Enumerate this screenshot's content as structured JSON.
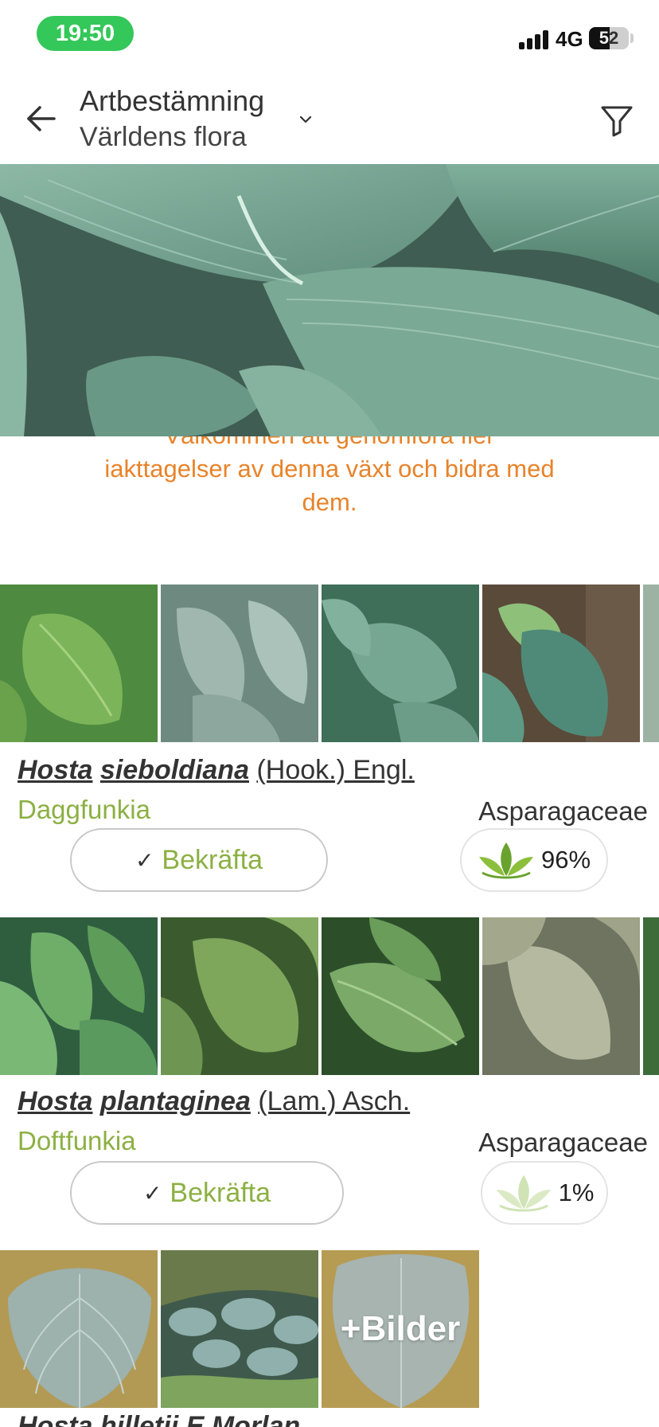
{
  "status_bar": {
    "time": "19:50",
    "network": "4G",
    "battery_percent": "52",
    "battery_level": 0.52
  },
  "header": {
    "title": "Artbestämning",
    "subtitle": "Världens flora",
    "back_icon": "arrow-left-icon",
    "dropdown_icon": "chevron-down-icon",
    "filter_icon": "filter-funnel-icon"
  },
  "info_text": {
    "partial_line": "Välkommen att genomföra fler",
    "line_2": "iakttagelser av denna växt och bidra med",
    "line_3": "dem."
  },
  "results": [
    {
      "genus": "Hosta",
      "species": "sieboldiana",
      "author": "(Hook.) Engl.",
      "common_name": "Daggfunkia",
      "family": "Asparagaceae",
      "confirm_label": "Bekräfta",
      "score": "96%",
      "score_icon": "leaves-icon"
    },
    {
      "genus": "Hosta",
      "species": "plantaginea",
      "author": "(Lam.) Asch.",
      "common_name": "Doftfunkia",
      "family": "Asparagaceae",
      "confirm_label": "Bekräfta",
      "score": "1%",
      "score_icon": "leaves-faded-icon"
    }
  ],
  "third_result": {
    "more_images_label": "+Bilder",
    "partial_title": "Hosta hilletii E Morlan"
  },
  "colors": {
    "accent_green": "#8cb043",
    "info_orange": "#e8832a",
    "time_pill": "#34c759"
  }
}
